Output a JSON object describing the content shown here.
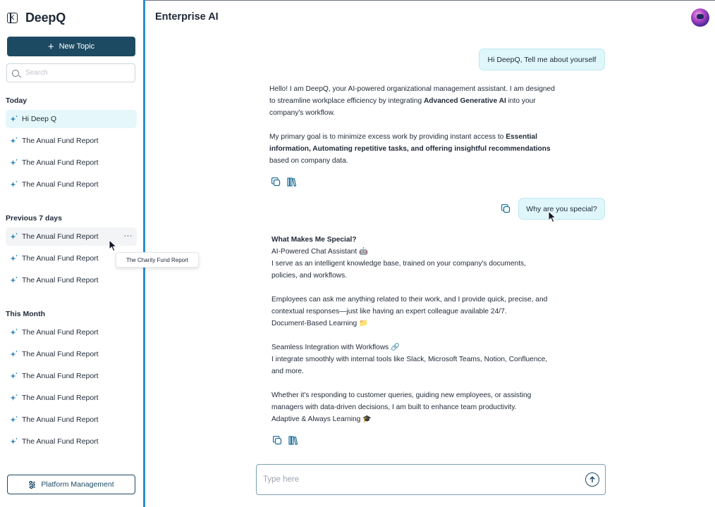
{
  "sidebar": {
    "brand": "DeepQ",
    "new_topic_label": "New Topic",
    "search_placeholder": "Search",
    "sections": {
      "today": "Today",
      "previous_7_days": "Previous 7 days",
      "this_month": "This Month"
    },
    "today_items": [
      "Hi Deep Q",
      "The Anual Fund Report",
      "The Anual Fund Report",
      "The Anual Fund Report"
    ],
    "previous_items": [
      "The Anual Fund Report",
      "The Anual Fund Report",
      "The Anual Fund Report"
    ],
    "month_items": [
      "The Anual Fund Report",
      "The Anual Fund Report",
      "The Anual Fund Report",
      "The Anual Fund Report",
      "The Anual Fund Report",
      "The Anual Fund Report"
    ],
    "more_label": "···",
    "tooltip": "The Charity Fund Report",
    "platform_label": "Platform Management"
  },
  "main": {
    "title": "Enterprise AI",
    "messages": {
      "user_1": "Hi DeepQ, Tell me about yourself",
      "ai_1": {
        "p1_a": "Hello! I am DeepQ, your AI-powered organizational management assistant. I am designed to streamline workplace efficiency by integrating ",
        "p1_bold": "Advanced Generative AI",
        "p1_b": " into your company's workflow.",
        "p2_a": "My primary goal is to minimize excess work by providing instant access to ",
        "p2_bold": "Essential information, Automating repetitive tasks, and offering insightful recommendations",
        "p2_b": " based on company data."
      },
      "user_2": "Why are you special?",
      "ai_2": {
        "heading": "What Makes Me Special?",
        "line1": "AI-Powered Chat Assistant 🤖",
        "line2": "I serve as an intelligent knowledge base, trained on your company's documents, policies, and workflows.",
        "line3": "Employees can ask me anything related to their work, and I provide quick, precise, and contextual responses—just like having an expert colleague available 24/7.",
        "line4": "Document-Based Learning 📁",
        "line5": "Seamless Integration with Workflows 🔗",
        "line6": "I integrate smoothly with internal tools like Slack, Microsoft Teams, Notion, Confluence, and more.",
        "line7": "Whether it's responding to customer queries, guiding new employees, or assisting managers with data-driven decisions, I am built to enhance team productivity.",
        "line8": "Adaptive & Always Learning 🎓"
      }
    },
    "composer_placeholder": "Type here"
  },
  "icons": {
    "brand": "collapse-sidebar-icon",
    "topic": "sparkle-icon",
    "copy": "copy-icon",
    "sources": "library-icon",
    "send": "arrow-up-circle-icon",
    "settings": "sliders-icon"
  },
  "colors": {
    "primary": "#1d4a63",
    "accent_bubble": "#dff6fb",
    "divider": "#2a8fd8",
    "active_topic": "#e6f7fb"
  }
}
